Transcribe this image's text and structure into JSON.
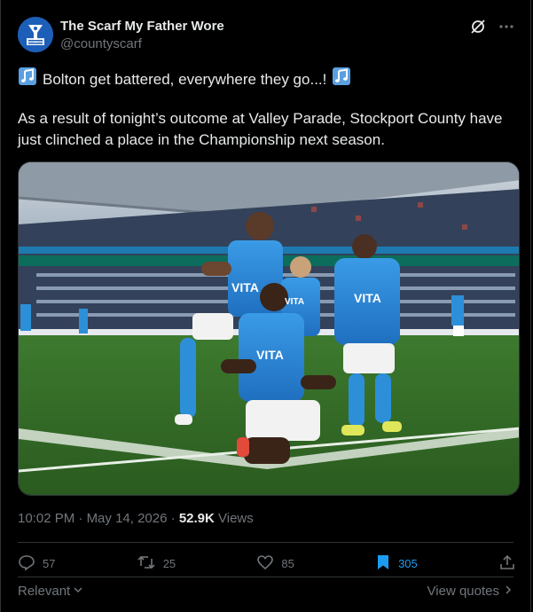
{
  "account": {
    "name": "The Scarf My Father Wore",
    "handle": "@countyscarf"
  },
  "tweet": {
    "line1": "Bolton get battered, everywhere they go...!",
    "line2": "As a result of tonight’s outcome at Valley Parade, Stockport County have just clinched a place in the Championship next season."
  },
  "meta": {
    "time": "10:02 PM",
    "sep1": " · ",
    "date": "May 14, 2026",
    "sep2": " · ",
    "views_count": "52.9K",
    "views_label": " Views"
  },
  "actions": {
    "replies": "57",
    "reposts": "25",
    "likes": "85",
    "bookmarks": "305"
  },
  "footer": {
    "relevant_label": "Relevant",
    "view_quotes_label": "View quotes"
  },
  "colors": {
    "accent": "#1d9bf0",
    "muted": "#71767b",
    "text": "#e7e9ea",
    "background": "#000000"
  }
}
